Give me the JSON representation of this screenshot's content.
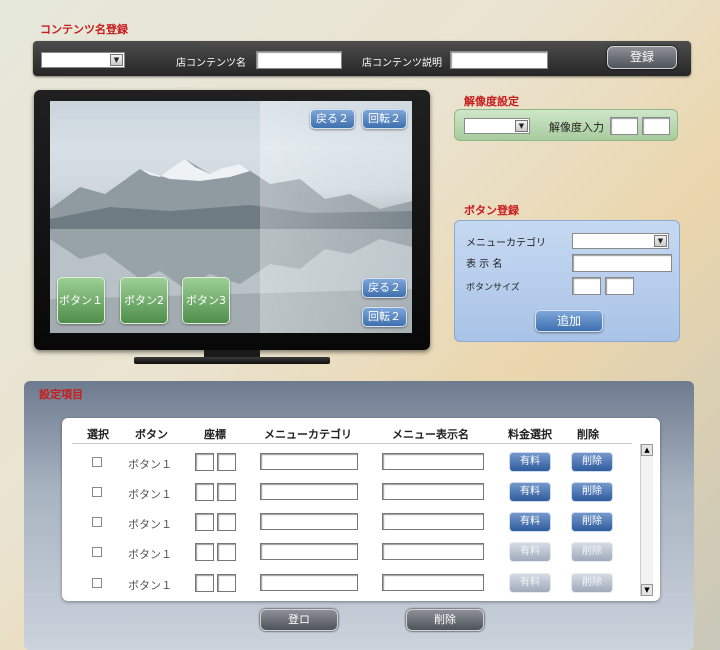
{
  "content_register": {
    "title": "コンテンツ名登録",
    "store_name_label": "店コンテンツ名",
    "store_desc_label": "店コンテンツ説明",
    "register_button": "登録",
    "category_select": "",
    "store_name_value": "",
    "store_desc_value": ""
  },
  "preview": {
    "top_back_button": "戻る２",
    "top_rotate_button": "回転２",
    "bottom_back_button": "戻る２",
    "bottom_rotate_button": "回転２",
    "buttons": [
      "ボタン１",
      "ボタン2",
      "ボタン3"
    ]
  },
  "resolution": {
    "title": "解像度設定",
    "input_label": "解像度入力",
    "select_value": "",
    "width_value": "",
    "height_value": ""
  },
  "button_register": {
    "title": "ボタン登録",
    "menu_category_label": "メニューカテゴリ",
    "display_name_label": "表 示 名",
    "button_size_label": "ボタンサイズ",
    "add_button": "追加",
    "menu_category_value": "",
    "display_name_value": ""
  },
  "settings": {
    "title": "設定項目",
    "columns": [
      "選択",
      "ボタン",
      "座標",
      "メニューカテゴリ",
      "メニュー表示名",
      "料金選択",
      "削除"
    ],
    "rows": [
      {
        "button": "ボタン１",
        "fee": "有料",
        "delete": "削除",
        "enabled": true
      },
      {
        "button": "ボタン１",
        "fee": "有料",
        "delete": "削除",
        "enabled": true
      },
      {
        "button": "ボタン１",
        "fee": "有料",
        "delete": "削除",
        "enabled": true
      },
      {
        "button": "ボタン１",
        "fee": "有料",
        "delete": "削除",
        "enabled": false
      },
      {
        "button": "ボタン１",
        "fee": "有料",
        "delete": "削除",
        "enabled": false
      }
    ],
    "register_button": "登ロ",
    "delete_button": "削除"
  },
  "icons": {
    "select_arrow": "chevron-down-icon",
    "scroll_up": "arrow-up-icon",
    "scroll_down": "arrow-down-icon"
  },
  "colors": {
    "label_red": "#c81d1d",
    "accent_blue": "#3e6fae",
    "accent_green": "#4f8e4a"
  }
}
